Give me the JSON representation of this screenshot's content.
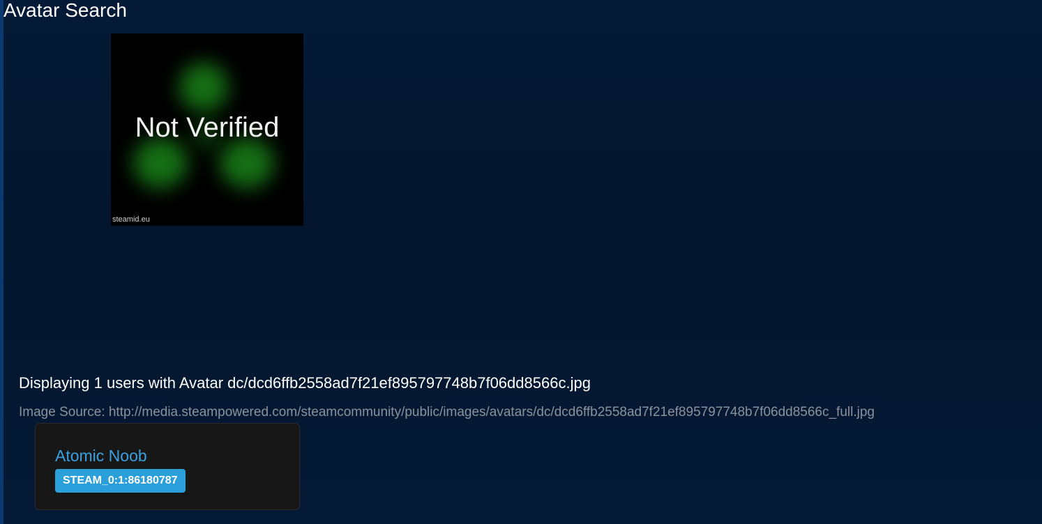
{
  "page": {
    "title": "Avatar Search"
  },
  "avatar": {
    "label": "Not Verified",
    "watermark": "steamid.eu"
  },
  "results": {
    "summary": "Displaying 1 users with Avatar dc/dcd6ffb2558ad7f21ef895797748b7f06dd8566c.jpg",
    "source": "Image Source: http://media.steampowered.com/steamcommunity/public/images/avatars/dc/dcd6ffb2558ad7f21ef895797748b7f06dd8566c_full.jpg"
  },
  "users": [
    {
      "name": "Atomic Noob",
      "steam_id": "STEAM_0:1:86180787"
    }
  ],
  "colors": {
    "background": "#041a36",
    "link": "#3aa0e0",
    "badge": "#2b9fd9",
    "card": "#171717",
    "muted_text": "#8b929c",
    "avatar_glow": "#1e9a1e"
  }
}
